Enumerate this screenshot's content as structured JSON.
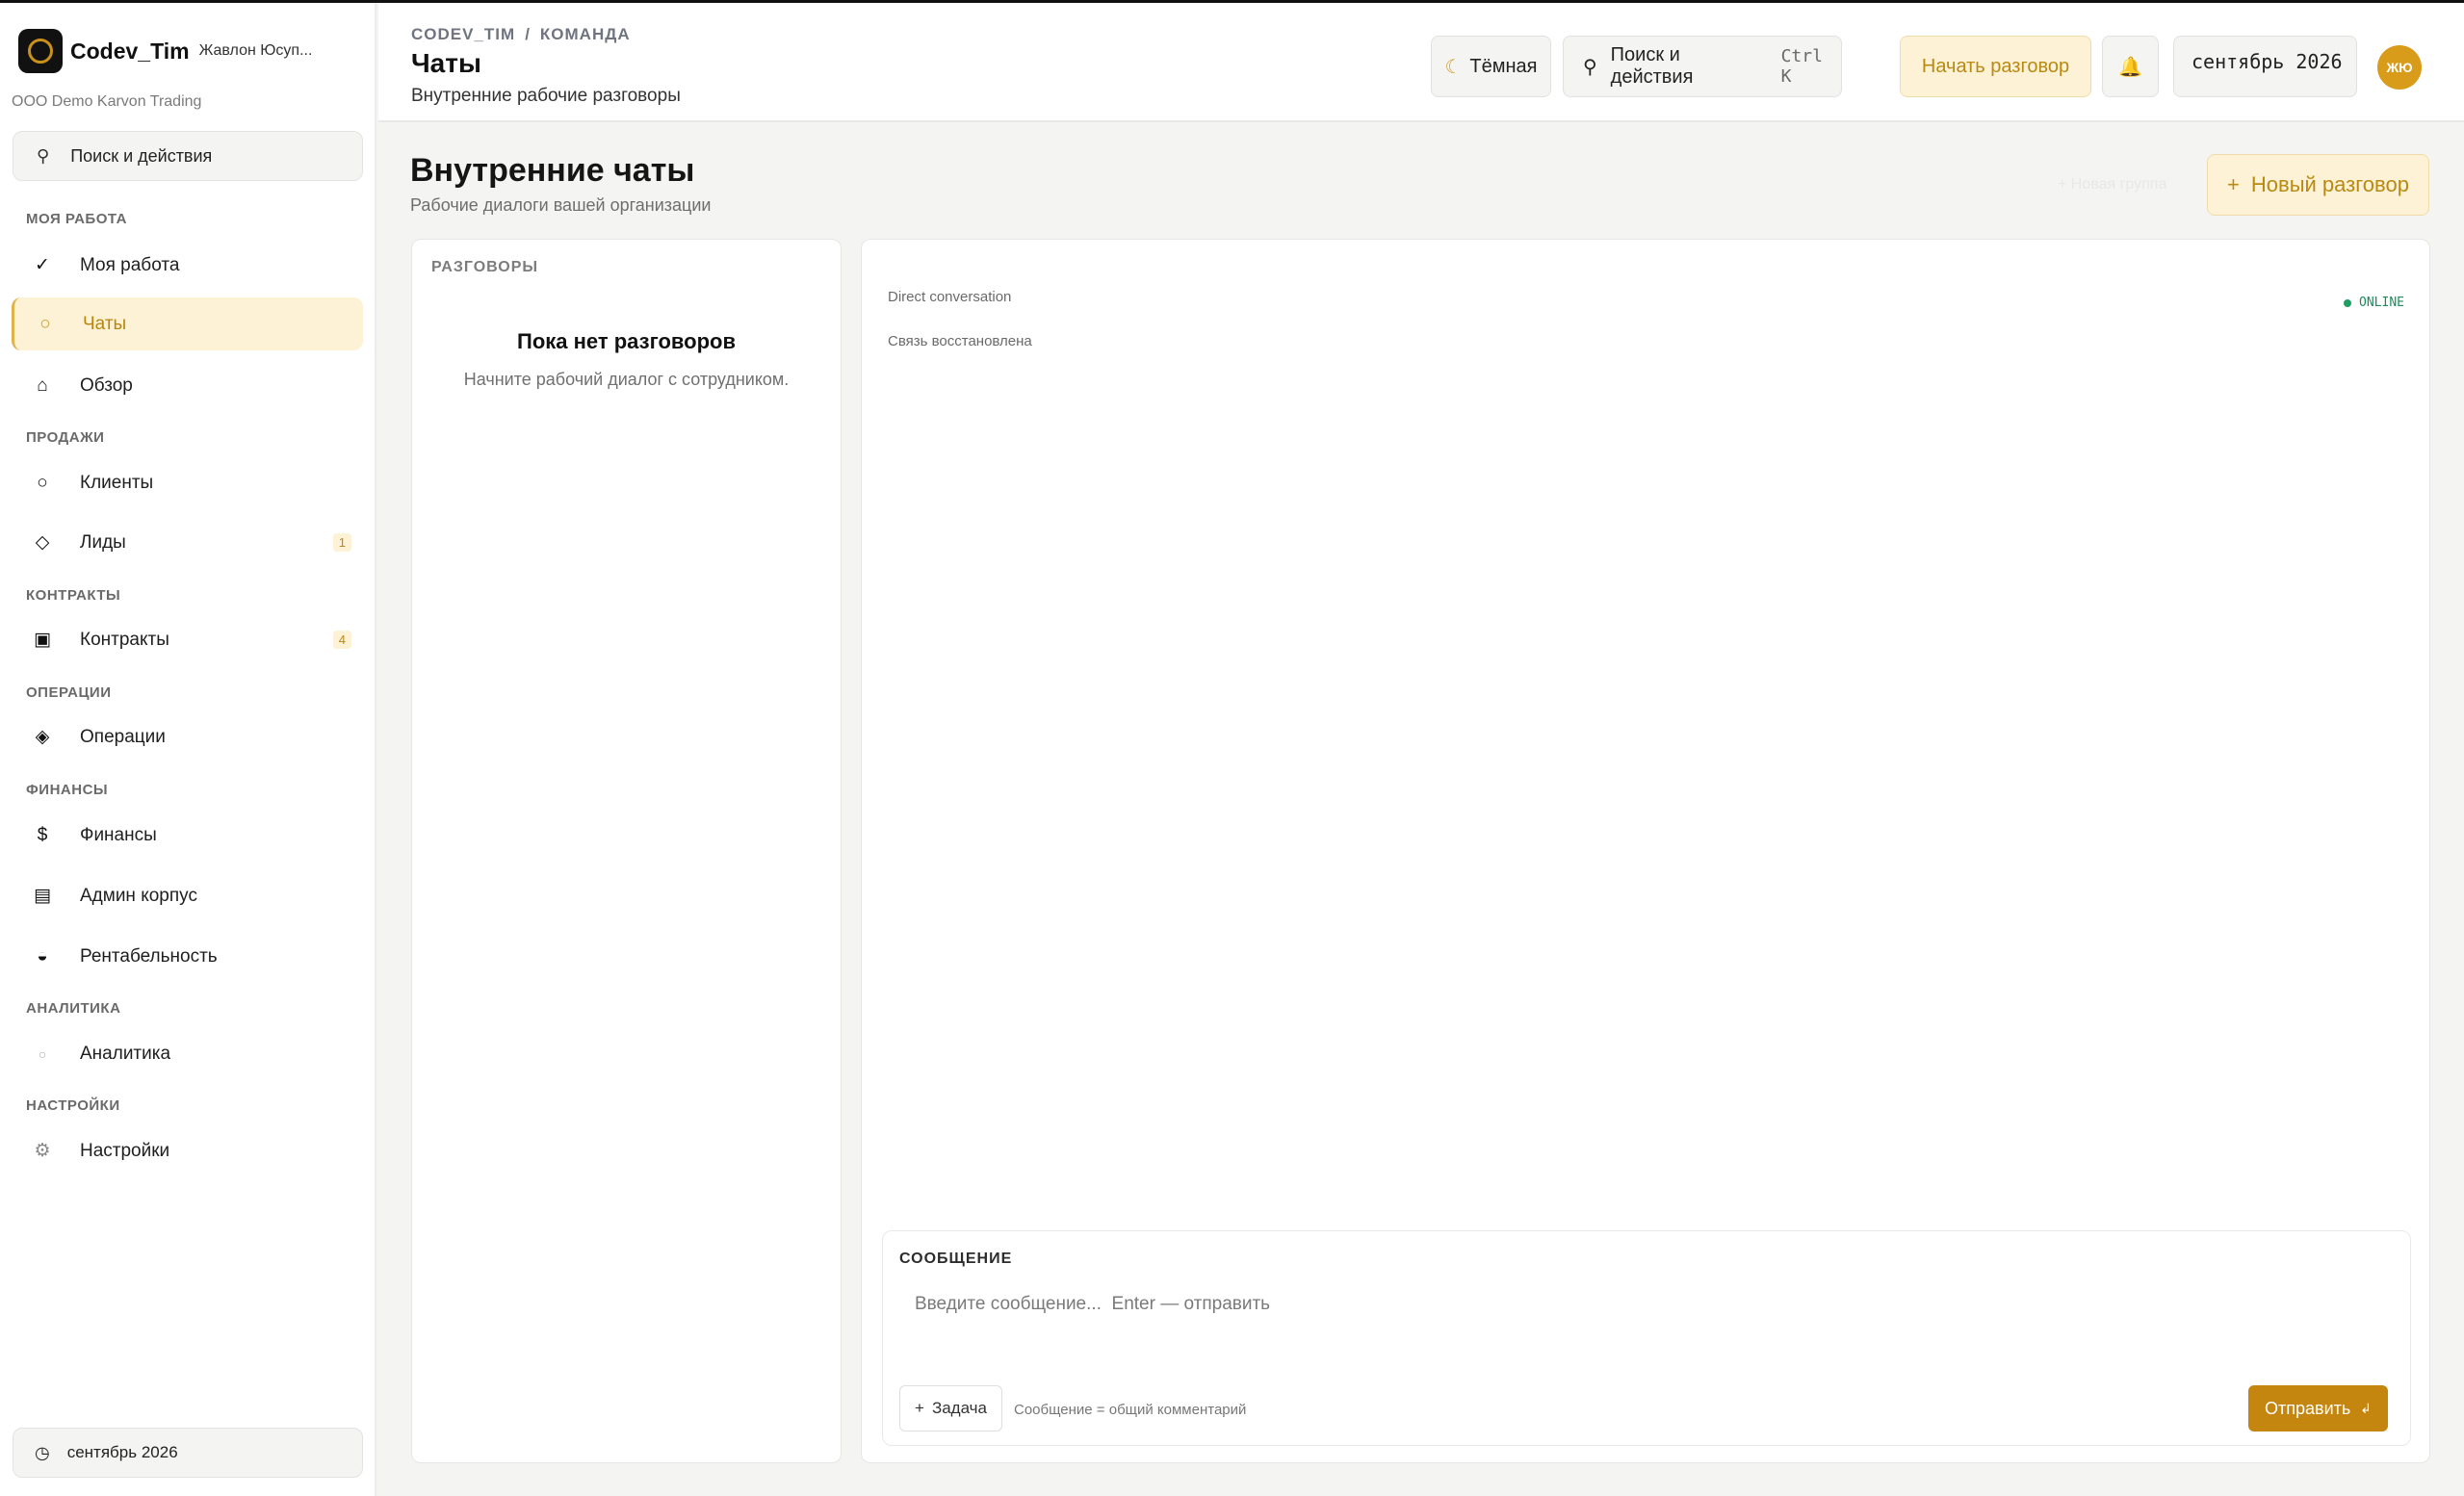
{
  "brand": {
    "name": "Codev_Tim",
    "user": "Жавлон Юсуп...",
    "org": "ООО Demo Karvon Trading"
  },
  "sidebar": {
    "search_label": "Поиск и действия",
    "sections": {
      "work": "МОЯ РАБОТА",
      "sales": "ПРОДАЖИ",
      "contracts": "КОНТРАКТЫ",
      "operations": "ОПЕРАЦИИ",
      "finance": "ФИНАНСЫ",
      "analytics": "АНАЛИТИКА",
      "settings": "НАСТРОЙКИ"
    },
    "items": {
      "my_work": "Моя работа",
      "chats": "Чаты",
      "overview": "Обзор",
      "clients": "Клиенты",
      "leads": "Лиды",
      "leads_badge": "1",
      "contracts": "Контракты",
      "contracts_badge": "4",
      "operations": "Операции",
      "finance": "Финансы",
      "admin": "Админ корпус",
      "profitability": "Рентабельность",
      "analytics": "Аналитика",
      "settings": "Настройки"
    },
    "period": "сентябрь 2026"
  },
  "topbar": {
    "breadcrumb_root": "CODEV_TIM",
    "breadcrumb_sep": "/",
    "breadcrumb_current": "КОМАНДА",
    "title": "Чаты",
    "subtitle": "Внутренние рабочие разговоры",
    "theme_label": "Тёмная",
    "search_label": "Поиск и действия",
    "search_shortcut": "Ctrl K",
    "start_conversation": "Начать разговор",
    "period": "сентябрь 2026",
    "avatar_initials": "ЖЮ"
  },
  "main": {
    "title": "Внутренние чаты",
    "subtitle": "Рабочие диалоги вашей организации",
    "new_group": "+ Новая группа",
    "new_conversation": "Новый разговор",
    "conversations": {
      "title": "РАЗГОВОРЫ",
      "empty_title": "Пока нет разговоров",
      "empty_subtitle": "Начните рабочий диалог с сотрудником."
    },
    "chat": {
      "type": "Direct conversation",
      "status": "Связь восстановлена",
      "online": "ONLINE"
    },
    "composer": {
      "title": "СООБЩЕНИЕ",
      "placeholder": "Введите сообщение...  Enter — отправить",
      "task_label": "Задача",
      "hint": "Сообщение = общий комментарий",
      "send_label": "Отправить"
    }
  },
  "colors": {
    "accent": "#c4860f",
    "accent_soft": "#fdf1d6",
    "online": "#1f9d63"
  }
}
